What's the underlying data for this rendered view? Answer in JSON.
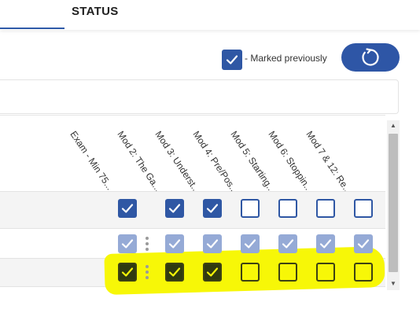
{
  "tabs": {
    "status_label": "STATUS"
  },
  "legend": {
    "label": "- Marked previously",
    "color": "#2f57a4"
  },
  "refresh": {
    "icon": "refresh-icon",
    "color": "#2e56a6"
  },
  "columns": [
    "Exam - Min 75...",
    "Mod 2: The Ga...",
    "Mod 3: Underst...",
    "Mod 4: Pre/Pos...",
    "Mod 5: Starting...",
    "Mod 6: Stoppin...",
    "Mod 7 & 12: Re..."
  ],
  "rows": [
    {
      "states": [
        "checked",
        "checked",
        "checked",
        "empty",
        "empty",
        "empty",
        "empty"
      ],
      "style": "dark"
    },
    {
      "states": [
        "checked",
        "checked",
        "checked",
        "checked",
        "checked",
        "checked",
        "checked"
      ],
      "style": "light"
    },
    {
      "states": [
        "checked",
        "checked",
        "checked",
        "empty",
        "empty",
        "empty",
        "empty"
      ],
      "style": "highlighted"
    }
  ],
  "highlight_color": "#f7f707"
}
